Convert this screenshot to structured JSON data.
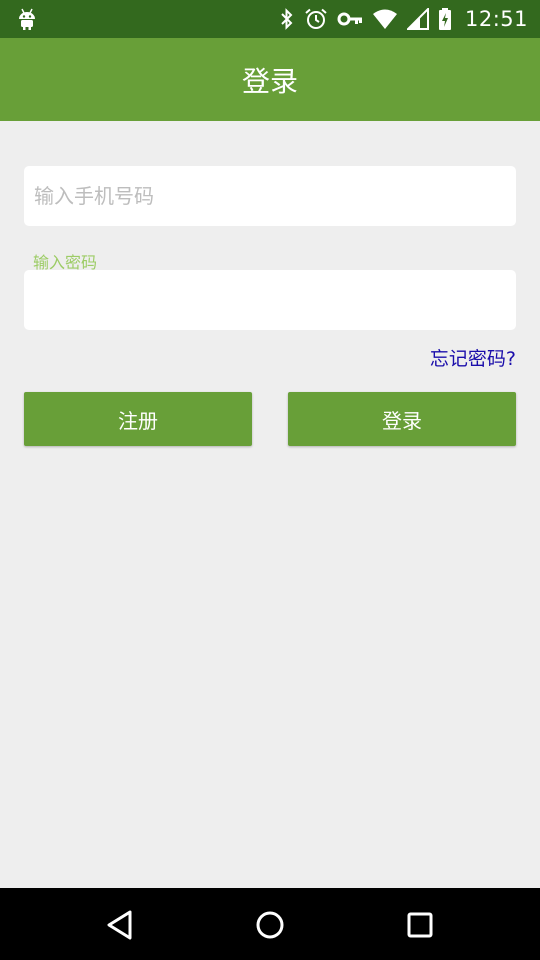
{
  "status_bar": {
    "time": "12:51",
    "icons": [
      "android-icon",
      "bluetooth-icon",
      "alarm-icon",
      "key-icon",
      "wifi-icon",
      "signal-icon",
      "battery-icon"
    ],
    "background": "#33691e"
  },
  "app_bar": {
    "title": "登录",
    "background": "#689f38"
  },
  "form": {
    "phone_placeholder": "输入手机号码",
    "phone_value": "",
    "password_label": "输入密码",
    "password_value": "",
    "forgot_password": "忘记密码?"
  },
  "buttons": {
    "register_label": "注册",
    "login_label": "登录",
    "color": "#689f38"
  },
  "nav_bar": {
    "icons": [
      "back-icon",
      "home-icon",
      "recents-icon"
    ]
  }
}
